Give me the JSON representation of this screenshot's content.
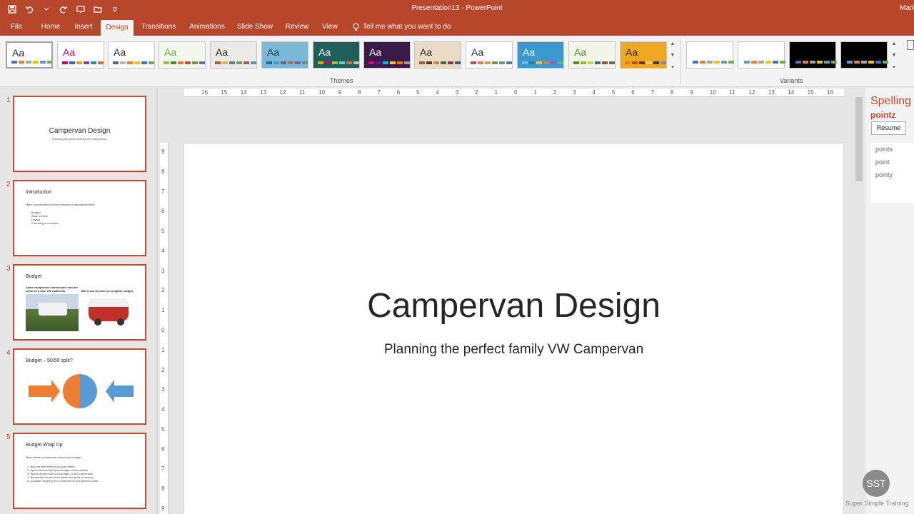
{
  "window": {
    "title": "Presentation13 - PowerPoint",
    "user": "Mark"
  },
  "qat": {
    "icons": [
      "save-icon",
      "undo-icon",
      "redo-icon",
      "start-from-beginning-icon",
      "open-icon",
      "customize-icon"
    ]
  },
  "tabs": [
    "File",
    "Home",
    "Insert",
    "Design",
    "Transitions",
    "Animations",
    "Slide Show",
    "Review",
    "View"
  ],
  "active_tab": "Design",
  "tellme": "Tell me what you want to do",
  "ribbon": {
    "themes_label": "Themes",
    "variants_label": "Variants",
    "theme_glyph": "Aa",
    "themes": [
      {
        "name": "office",
        "bg": "#ffffff",
        "fg": "#262626",
        "colors": [
          "#4472c4",
          "#ed7d31",
          "#a5a5a5",
          "#ffc000",
          "#5b9bd5",
          "#70ad47"
        ]
      },
      {
        "name": "ion",
        "bg": "#ffffff",
        "fg": "#d0006f",
        "colors": [
          "#d0006f",
          "#1e6ec8",
          "#e6a700",
          "#8a3ab9",
          "#00a3a3",
          "#f2662d"
        ]
      },
      {
        "name": "facet",
        "bg": "#ffffff",
        "fg": "#262626",
        "colors": [
          "#5a6674",
          "#b6b6b6",
          "#ed7d31",
          "#ffc000",
          "#4472c4",
          "#70ad47"
        ]
      },
      {
        "name": "wisp",
        "bg": "#f4f8ec",
        "fg": "#6fb23b",
        "colors": [
          "#90c040",
          "#4a8a2a",
          "#e87a2a",
          "#c0504d",
          "#7a9a3a",
          "#4a7a9a"
        ]
      },
      {
        "name": "retrospect",
        "bg": "#eceae6",
        "fg": "#262626",
        "colors": [
          "#a85a3a",
          "#e6b54a",
          "#5a7a9a",
          "#7a9a5a",
          "#9a5a7a",
          "#5a9a9a"
        ]
      },
      {
        "name": "dividend",
        "bg": "#7ab8d8",
        "fg": "#1a3a5a",
        "colors": [
          "#1a6aa0",
          "#3a9ad0",
          "#5a6a7a",
          "#9a7a5a",
          "#7a5a9a",
          "#5a9a7a"
        ]
      },
      {
        "name": "ion-boardroom",
        "bg": "#1f5f59",
        "fg": "#ffffff",
        "colors": [
          "#e6a700",
          "#d0006f",
          "#9ac83a",
          "#5ad0e0",
          "#f2662d",
          "#c0c0c0"
        ]
      },
      {
        "name": "vapor-trail",
        "bg": "#3a1a4a",
        "fg": "#ffffff",
        "colors": [
          "#e6007a",
          "#5a1a8a",
          "#00c0d0",
          "#ffd000",
          "#e67a00",
          "#9a9a9a"
        ]
      },
      {
        "name": "organic",
        "bg": "#eadcc4",
        "fg": "#262626",
        "colors": [
          "#8a6a3a",
          "#5a3a1a",
          "#c08a4a",
          "#4a6a3a",
          "#8a3a3a",
          "#3a5a7a"
        ]
      },
      {
        "name": "savon",
        "bg": "#ffffff",
        "fg": "#262626",
        "colors": [
          "#c0504d",
          "#e07a5a",
          "#d0a050",
          "#8a8a5a",
          "#6a9a8a",
          "#5a7a9a"
        ]
      },
      {
        "name": "mesh",
        "bg": "#3a9ad0",
        "fg": "#ffffff",
        "colors": [
          "#6ac0e6",
          "#3a7aa0",
          "#e6c03a",
          "#e67a3a",
          "#9a5ac0",
          "#5ac07a"
        ]
      },
      {
        "name": "slice",
        "bg": "#f2f6e6",
        "fg": "#5a7a2a",
        "colors": [
          "#5a8a2a",
          "#8ac03a",
          "#c0d06a",
          "#3a6a8a",
          "#8a5a3a",
          "#6a6a6a"
        ]
      },
      {
        "name": "berlin",
        "bg": "#f0a820",
        "fg": "#262626",
        "colors": [
          "#e67a1a",
          "#c0501a",
          "#5a3a1a",
          "#ffd050",
          "#3a3a3a",
          "#8a8a8a"
        ]
      }
    ],
    "variants": [
      {
        "name": "variant-1",
        "bg": "#ffffff",
        "colors": [
          "#4472c4",
          "#ed7d31",
          "#a5a5a5",
          "#ffc000",
          "#5b9bd5",
          "#70ad47"
        ]
      },
      {
        "name": "variant-2",
        "bg": "#ffffff",
        "colors": [
          "#5b9bd5",
          "#ed7d31",
          "#a5a5a5",
          "#ffc000",
          "#4472c4",
          "#70ad47"
        ]
      },
      {
        "name": "variant-3",
        "bg": "#000000",
        "colors": [
          "#4472c4",
          "#ed7d31",
          "#a5a5a5",
          "#ffc000",
          "#5b9bd5",
          "#70ad47"
        ]
      },
      {
        "name": "variant-4",
        "bg": "#000000",
        "colors": [
          "#5b9bd5",
          "#ed7d31",
          "#a5a5a5",
          "#ffc000",
          "#4472c4",
          "#70ad47"
        ]
      }
    ]
  },
  "slides": [
    {
      "num": "1",
      "title": "Campervan Design",
      "subtitle": "Planning the perfect family VW Campervan",
      "layout": "title"
    },
    {
      "num": "2",
      "title": "Introduction",
      "body": "Main considerations when planning a campervan build:",
      "bullets": [
        "Budget",
        "Base vehicle",
        "Layout",
        "Choosing a converter"
      ],
      "layout": "content"
    },
    {
      "num": "3",
      "title": "Budget",
      "body": "Some campervan conversions can the same as a new VW California",
      "body2": "But it can be done on a tighter budget",
      "layout": "images"
    },
    {
      "num": "4",
      "title": "Budget – 50/50 split?",
      "layout": "diagram"
    },
    {
      "num": "5",
      "title": "Budget Wrap Up",
      "body": "Main points to remember about your budget:",
      "bullets": [
        "1.  Buy the best vehicle you can afford",
        "2.  Spend around half your budget on the vehicle",
        "3.  Spend around half your budget on the conversion",
        "4.  Remember to set some aside to pay for insurance",
        "5.  Consider keeping 5% in reserve for unexpected costs"
      ],
      "layout": "content"
    }
  ],
  "ruler": {
    "h_ticks": [
      "16",
      "15",
      "14",
      "13",
      "12",
      "11",
      "10",
      "9",
      "8",
      "7",
      "6",
      "5",
      "4",
      "3",
      "2",
      "1",
      "0",
      "1",
      "2",
      "3",
      "4",
      "5",
      "6",
      "7",
      "8",
      "9",
      "10",
      "11",
      "12",
      "13",
      "14",
      "15",
      "16"
    ],
    "v_ticks": [
      "9",
      "8",
      "7",
      "6",
      "5",
      "4",
      "3",
      "2",
      "1",
      "0",
      "1",
      "2",
      "3",
      "4",
      "5",
      "6",
      "7",
      "8",
      "9"
    ]
  },
  "main_slide": {
    "title": "Campervan Design",
    "subtitle": "Planning the perfect family VW Campervan"
  },
  "spelling": {
    "heading": "Spelling",
    "word": "pointz",
    "resume": "Resume",
    "suggestions": [
      "points",
      "point",
      "pointy"
    ]
  },
  "watermark": {
    "logo": "SST",
    "label": "Super Simple Training"
  }
}
